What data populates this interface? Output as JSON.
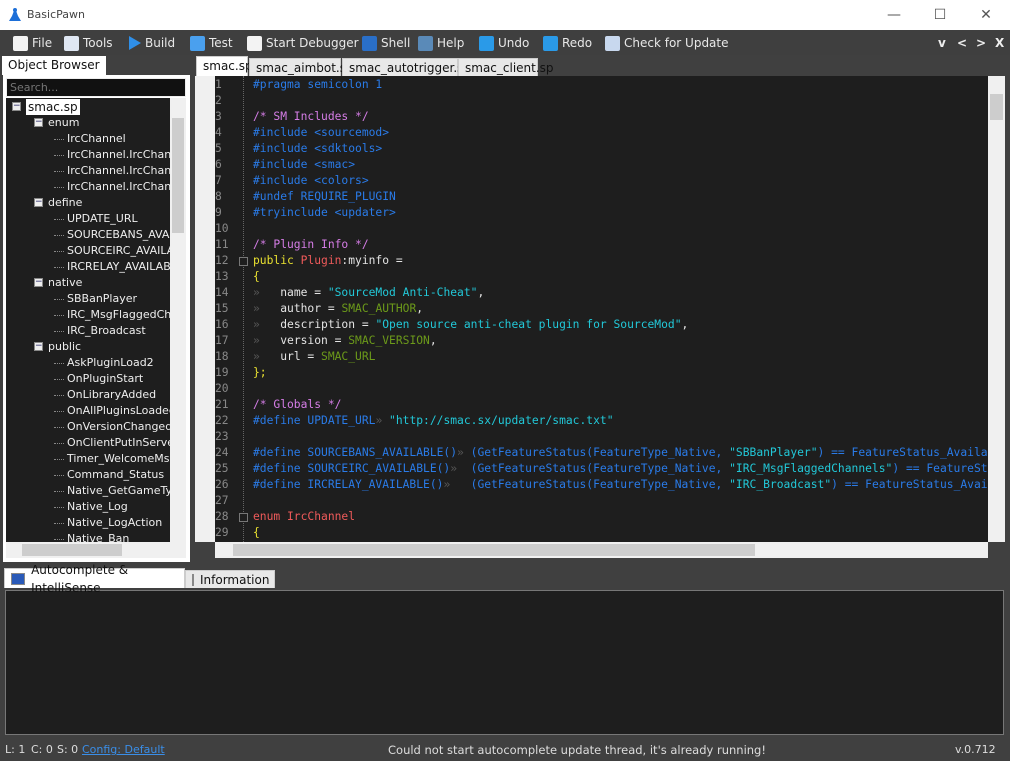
{
  "window": {
    "title": "BasicPawn",
    "min": "—",
    "max": "☐",
    "close": "✕"
  },
  "menu": [
    {
      "label": "File",
      "icon": "file-edit-icon"
    },
    {
      "label": "Tools",
      "icon": "tools-icon"
    },
    {
      "label": "Build",
      "icon": "play-icon"
    },
    {
      "label": "Test",
      "icon": "grid-icon"
    },
    {
      "label": "Start Debugger",
      "icon": "debugger-icon"
    },
    {
      "label": "Shell",
      "icon": "shell-icon"
    },
    {
      "label": "Help",
      "icon": "help-icon"
    },
    {
      "label": "Undo",
      "icon": "undo-icon"
    },
    {
      "label": "Redo",
      "icon": "redo-icon"
    },
    {
      "label": "Check for Update",
      "icon": "update-icon"
    }
  ],
  "nav": {
    "down": "v",
    "prev": "<",
    "next": ">",
    "close": "X"
  },
  "object_browser": {
    "tab": "Object Browser",
    "search_placeholder": "Search...",
    "tree": [
      {
        "label": "smac.sp",
        "level": 0,
        "expanded": true,
        "selected": true
      },
      {
        "label": "enum",
        "level": 1,
        "expanded": true
      },
      {
        "label": "IrcChannel",
        "level": 2
      },
      {
        "label": "IrcChannel.IrcChannel_Public",
        "level": 2
      },
      {
        "label": "IrcChannel.IrcChannel_Private",
        "level": 2
      },
      {
        "label": "IrcChannel.IrcChannel_Both",
        "level": 2
      },
      {
        "label": "define",
        "level": 1,
        "expanded": true
      },
      {
        "label": "UPDATE_URL",
        "level": 2
      },
      {
        "label": "SOURCEBANS_AVAILABLE",
        "level": 2
      },
      {
        "label": "SOURCEIRC_AVAILABLE",
        "level": 2
      },
      {
        "label": "IRCRELAY_AVAILABLE",
        "level": 2
      },
      {
        "label": "native",
        "level": 1,
        "expanded": true
      },
      {
        "label": "SBBanPlayer",
        "level": 2
      },
      {
        "label": "IRC_MsgFlaggedChannels",
        "level": 2
      },
      {
        "label": "IRC_Broadcast",
        "level": 2
      },
      {
        "label": "public",
        "level": 1,
        "expanded": true
      },
      {
        "label": "AskPluginLoad2",
        "level": 2
      },
      {
        "label": "OnPluginStart",
        "level": 2
      },
      {
        "label": "OnLibraryAdded",
        "level": 2
      },
      {
        "label": "OnAllPluginsLoaded",
        "level": 2
      },
      {
        "label": "OnVersionChanged",
        "level": 2
      },
      {
        "label": "OnClientPutInServer",
        "level": 2
      },
      {
        "label": "Timer_WelcomeMsg",
        "level": 2
      },
      {
        "label": "Command_Status",
        "level": 2
      },
      {
        "label": "Native_GetGameType",
        "level": 2
      },
      {
        "label": "Native_Log",
        "level": 2
      },
      {
        "label": "Native_LogAction",
        "level": 2
      },
      {
        "label": "Native_Ban",
        "level": 2
      }
    ]
  },
  "editor_tabs": [
    {
      "label": "smac.sp",
      "active": true
    },
    {
      "label": "smac_aimbot.sp"
    },
    {
      "label": "smac_autotrigger.sp"
    },
    {
      "label": "smac_client.sp"
    }
  ],
  "code": [
    [
      [
        "#pragma semicolon 1",
        "kw"
      ]
    ],
    [],
    [
      [
        "/* SM Includes */",
        "cm"
      ]
    ],
    [
      [
        "#include <sourcemod>",
        "kw"
      ]
    ],
    [
      [
        "#include <sdktools>",
        "kw"
      ]
    ],
    [
      [
        "#include <smac>",
        "kw"
      ]
    ],
    [
      [
        "#include <colors>",
        "kw"
      ]
    ],
    [
      [
        "#undef REQUIRE_PLUGIN",
        "kw"
      ]
    ],
    [
      [
        "#tryinclude <updater>",
        "kw"
      ]
    ],
    [],
    [
      [
        "/* Plugin Info */",
        "cm"
      ]
    ],
    [
      [
        "public ",
        "yl"
      ],
      [
        "Plugin",
        "rd"
      ],
      [
        ":myinfo =",
        "tx"
      ]
    ],
    [
      [
        "{",
        "yl"
      ]
    ],
    [
      [
        "»   ",
        "ws"
      ],
      [
        "name = ",
        "tx"
      ],
      [
        "\"SourceMod Anti-Cheat\"",
        "st"
      ],
      [
        ",",
        "tx"
      ]
    ],
    [
      [
        "»   ",
        "ws"
      ],
      [
        "author = ",
        "tx"
      ],
      [
        "SMAC_AUTHOR",
        "cn"
      ],
      [
        ",",
        "tx"
      ]
    ],
    [
      [
        "»   ",
        "ws"
      ],
      [
        "description = ",
        "tx"
      ],
      [
        "\"Open source anti-cheat plugin for SourceMod\"",
        "st"
      ],
      [
        ",",
        "tx"
      ]
    ],
    [
      [
        "»   ",
        "ws"
      ],
      [
        "version = ",
        "tx"
      ],
      [
        "SMAC_VERSION",
        "cn"
      ],
      [
        ",",
        "tx"
      ]
    ],
    [
      [
        "»   ",
        "ws"
      ],
      [
        "url = ",
        "tx"
      ],
      [
        "SMAC_URL",
        "cn"
      ]
    ],
    [
      [
        "};",
        "yl"
      ]
    ],
    [],
    [
      [
        "/* Globals */",
        "cm"
      ]
    ],
    [
      [
        "#define UPDATE_URL",
        "kw"
      ],
      [
        "» ",
        "ws"
      ],
      [
        "\"http://smac.sx/updater/smac.txt\"",
        "st"
      ]
    ],
    [],
    [
      [
        "#define SOURCEBANS_AVAILABLE()",
        "kw"
      ],
      [
        "» ",
        "ws"
      ],
      [
        "(GetFeatureStatus(FeatureType_Native, ",
        "kw"
      ],
      [
        "\"SBBanPlayer\"",
        "st"
      ],
      [
        ") == FeatureStatus_Available)",
        "kw"
      ]
    ],
    [
      [
        "#define SOURCEIRC_AVAILABLE()",
        "kw"
      ],
      [
        "»  ",
        "ws"
      ],
      [
        "(GetFeatureStatus(FeatureType_Native, ",
        "kw"
      ],
      [
        "\"IRC_MsgFlaggedChannels\"",
        "st"
      ],
      [
        ") == FeatureStatus_Available)",
        "kw"
      ]
    ],
    [
      [
        "#define IRCRELAY_AVAILABLE()",
        "kw"
      ],
      [
        "»   ",
        "ws"
      ],
      [
        "(GetFeatureStatus(FeatureType_Native, ",
        "kw"
      ],
      [
        "\"IRC_Broadcast\"",
        "st"
      ],
      [
        ") == FeatureStatus_Available)",
        "kw"
      ]
    ],
    [],
    [
      [
        "enum IrcChannel",
        "rd"
      ]
    ],
    [
      [
        "{",
        "yl"
      ]
    ]
  ],
  "bottom_tabs": [
    {
      "label": "Autocomplete & IntelliSense",
      "active": true,
      "icon": "autocomplete-icon"
    },
    {
      "label": "Information",
      "icon": "information-icon"
    }
  ],
  "status": {
    "line": "L: 1",
    "col": "C: 0",
    "sel": "S: 0",
    "config": "Config: Default",
    "message": "Could not start autocomplete update thread, it's already running!",
    "version": "v.0.712"
  },
  "colors": {
    "keyword": "#2a7be8",
    "comment": "#d57de6",
    "string": "#22c8d8",
    "constant": "#6c9a1a",
    "type": "#ee5a5a",
    "public": "#e8e030",
    "link": "#3a8ee8"
  }
}
